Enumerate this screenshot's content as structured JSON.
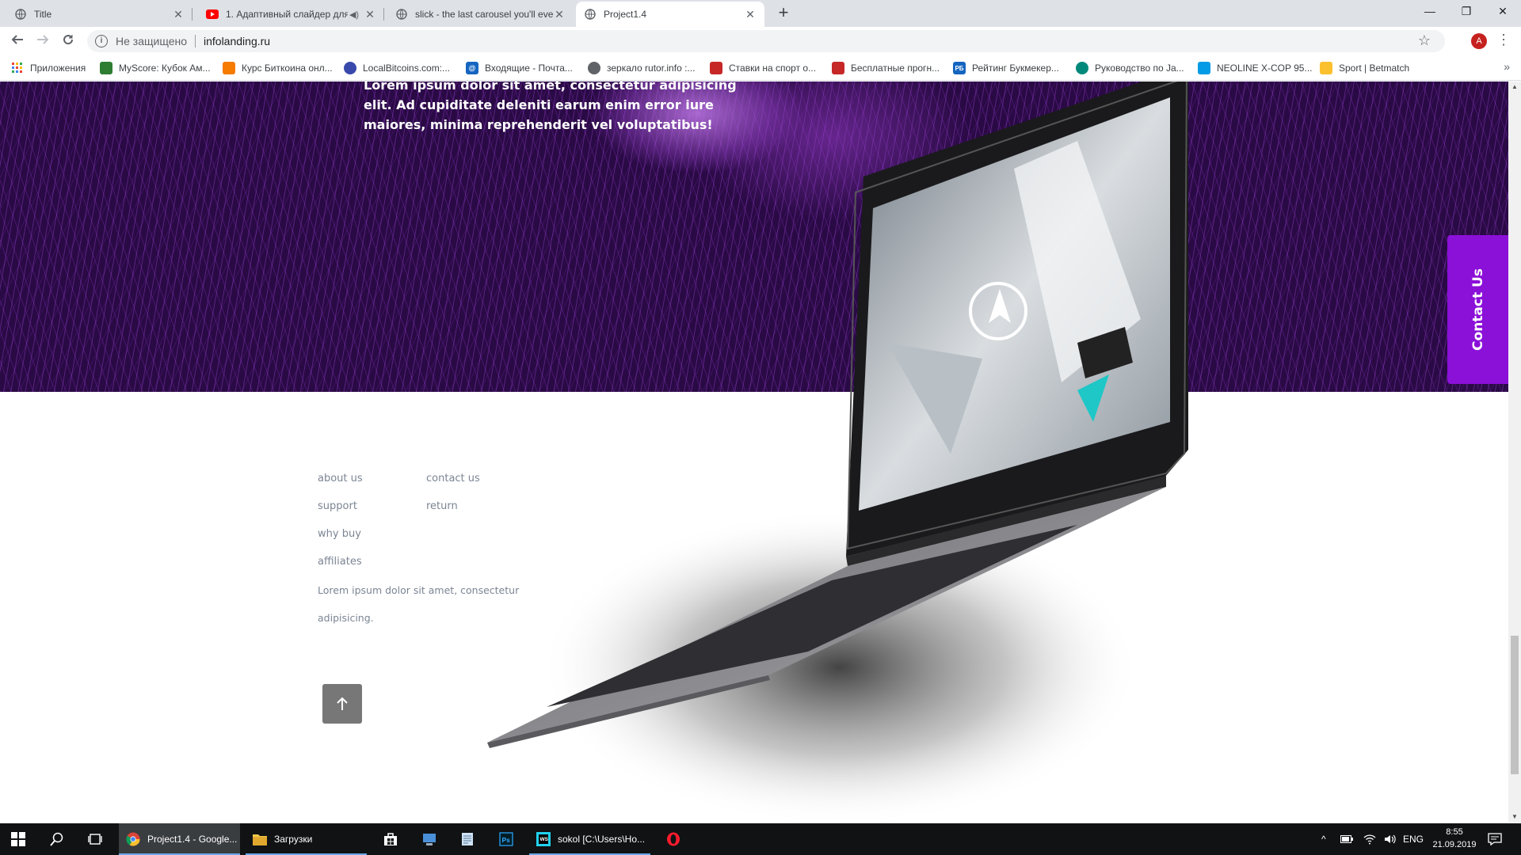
{
  "browser": {
    "tabs": [
      {
        "title": "Title",
        "active": false
      },
      {
        "title": "1. Адаптивный слайдер для",
        "active": false
      },
      {
        "title": "slick - the last carousel you'll eve",
        "active": false
      },
      {
        "title": "Project1.4",
        "active": true
      }
    ],
    "security_label": "Не защищено",
    "url": "infolanding.ru",
    "profile_initial": "A"
  },
  "bookmarks": [
    {
      "label": "Приложения",
      "color": "#ea4335"
    },
    {
      "label": "MyScore: Кубок Ам...",
      "color": "#2e7d32"
    },
    {
      "label": "Курс Биткоина онл...",
      "color": "#f57c00"
    },
    {
      "label": "LocalBitcoins.com:...",
      "color": "#3949ab"
    },
    {
      "label": "Входящие - Почта...",
      "color": "#1565c0"
    },
    {
      "label": "зеркало rutor.info :...",
      "color": "#5f6368"
    },
    {
      "label": "Ставки на спорт о...",
      "color": "#c62828"
    },
    {
      "label": "Бесплатные прогн...",
      "color": "#c62828"
    },
    {
      "label": "Рейтинг Букмекер...",
      "color": "#1565c0"
    },
    {
      "label": "Руководство по Ja...",
      "color": "#00897b"
    },
    {
      "label": "NEOLINE X-COP 95...",
      "color": "#039be5"
    },
    {
      "label": "Sport | Betmatch",
      "color": "#fbc02d"
    }
  ],
  "hero": {
    "text": "Lorem ipsum dolor sit amet, consectetur adipisicing elit. Ad cupiditate deleniti earum enim error iure maiores, minima reprehenderit vel voluptatibus!",
    "background_color": "#2a0a45"
  },
  "contact_tab": {
    "label": "Contact Us",
    "color": "#8b10d8"
  },
  "footer": {
    "links_col1": [
      "about us",
      "support",
      "why buy",
      "affiliates"
    ],
    "links_col2": [
      "contact us",
      "return"
    ],
    "description": "Lorem ipsum dolor sit amet, consectetur adipisicing.",
    "to_top_icon": "arrow-up-icon"
  },
  "taskbar": {
    "apps": [
      {
        "label": "Project1.4 - Google...",
        "icon": "chrome-icon",
        "active": true
      },
      {
        "label": "Загрузки",
        "icon": "folder-icon",
        "active": false
      },
      {
        "label": "sokol [C:\\Users\\Ho...",
        "icon": "webstorm-icon",
        "active": false
      }
    ],
    "language": "ENG",
    "time": "8:55",
    "date": "21.09.2019"
  }
}
